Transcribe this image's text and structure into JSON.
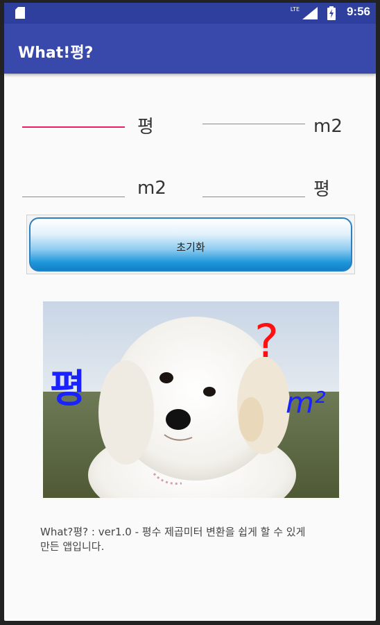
{
  "status_bar": {
    "network_label": "LTE",
    "time": "9:56"
  },
  "app_bar": {
    "title": "What!평?"
  },
  "converter": {
    "row1": {
      "unit_left": "평",
      "unit_right": "m2"
    },
    "row2": {
      "unit_left": "m2",
      "unit_right": "평"
    }
  },
  "reset_button": {
    "label": "초기화"
  },
  "image": {
    "overlay_left": "평",
    "overlay_question": "?",
    "overlay_right": "m²"
  },
  "description": "What?평? : ver1.0 - 평수 제곱미터 변환을 쉽게 할 수 있게 만든 앱입니다.",
  "colors": {
    "status_bar": "#2e3f9e",
    "app_bar": "#3949ab",
    "accent": "#e91e63"
  }
}
